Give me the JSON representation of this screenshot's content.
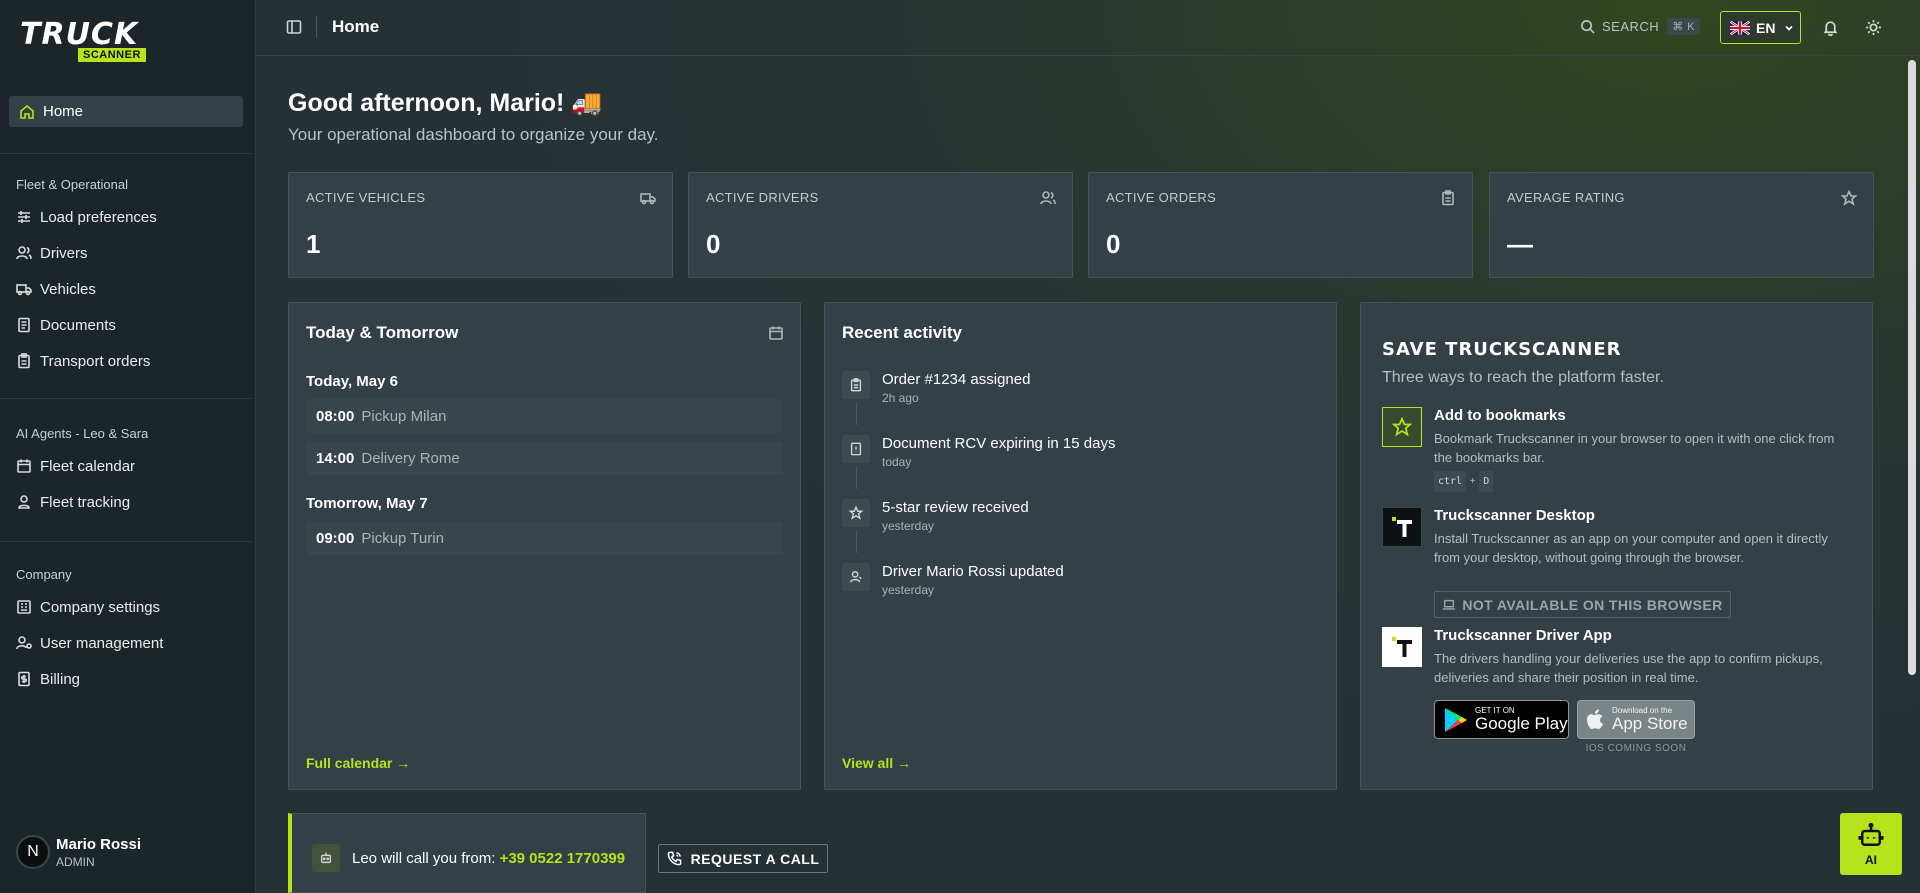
{
  "brand": {
    "name_top": "TRUCK",
    "name_bottom": "SCANNER"
  },
  "sidebar": {
    "home": "Home",
    "sections": [
      {
        "title": "Fleet & Operational",
        "items": [
          "Load preferences",
          "Drivers",
          "Vehicles",
          "Documents",
          "Transport orders"
        ]
      },
      {
        "title": "AI Agents - Leo & Sara",
        "items": [
          "Fleet calendar",
          "Fleet tracking"
        ]
      },
      {
        "title": "Company",
        "items": [
          "Company settings",
          "User management",
          "Billing"
        ]
      }
    ],
    "user": {
      "initial": "N",
      "name": "Mario Rossi",
      "role": "ADMIN"
    }
  },
  "topbar": {
    "title": "Home",
    "search_label": "SEARCH",
    "search_shortcut": "⌘ K",
    "language": "EN"
  },
  "greeting": {
    "title": "Good afternoon, Mario! 🚚",
    "subtitle": "Your operational dashboard to organize your day."
  },
  "stats": [
    {
      "label": "ACTIVE VEHICLES",
      "value": "1",
      "icon": "truck-icon"
    },
    {
      "label": "ACTIVE DRIVERS",
      "value": "0",
      "icon": "users-icon"
    },
    {
      "label": "ACTIVE ORDERS",
      "value": "0",
      "icon": "clipboard-icon"
    },
    {
      "label": "AVERAGE RATING",
      "value": "—",
      "icon": "star-icon"
    }
  ],
  "schedule": {
    "title": "Today & Tomorrow",
    "days": [
      {
        "label": "Today, May 6",
        "events": [
          {
            "time": "08:00",
            "what": "Pickup Milan"
          },
          {
            "time": "14:00",
            "what": "Delivery Rome"
          }
        ]
      },
      {
        "label": "Tomorrow, May 7",
        "events": [
          {
            "time": "09:00",
            "what": "Pickup Turin"
          }
        ]
      }
    ],
    "link": "Full calendar →"
  },
  "activity": {
    "title": "Recent activity",
    "items": [
      {
        "text": "Order #1234 assigned",
        "when": "2h ago",
        "icon": "clipboard-icon"
      },
      {
        "text": "Document RCV expiring in 15 days",
        "when": "today",
        "icon": "document-alert-icon"
      },
      {
        "text": "5-star review received",
        "when": "yesterday",
        "icon": "star-icon"
      },
      {
        "text": "Driver Mario Rossi updated",
        "when": "yesterday",
        "icon": "user-icon"
      }
    ],
    "link": "View all →"
  },
  "save": {
    "title": "SAVE TRUCKSCANNER",
    "subtitle": "Three ways to reach the platform faster.",
    "bookmarks": {
      "title": "Add to bookmarks",
      "desc": "Bookmark Truckscanner in your browser to open it with one click from the bookmarks bar.",
      "key1": "ctrl",
      "plus": "+",
      "key2": "D"
    },
    "desktop": {
      "title": "Truckscanner Desktop",
      "desc": "Install Truckscanner as an app on your computer and open it directly from your desktop, without going through the browser.",
      "button": "NOT AVAILABLE ON THIS BROWSER"
    },
    "driver_app": {
      "title": "Truckscanner Driver App",
      "desc": "The drivers handling your deliveries use the app to confirm pickups, deliveries and share their position in real time.",
      "gp_small": "GET IT ON",
      "gp_big": "Google Play",
      "as_small": "Download on the",
      "as_big": "App Store",
      "ios_note": "IOS COMING SOON"
    }
  },
  "call": {
    "prefix": "Leo will call you from: ",
    "number": "+39 0522 1770399",
    "button": "REQUEST A CALL"
  },
  "ai_button": "AI",
  "colors": {
    "accent": "#b6e31c",
    "sidebar": "#1c262a",
    "card": "#334046"
  }
}
